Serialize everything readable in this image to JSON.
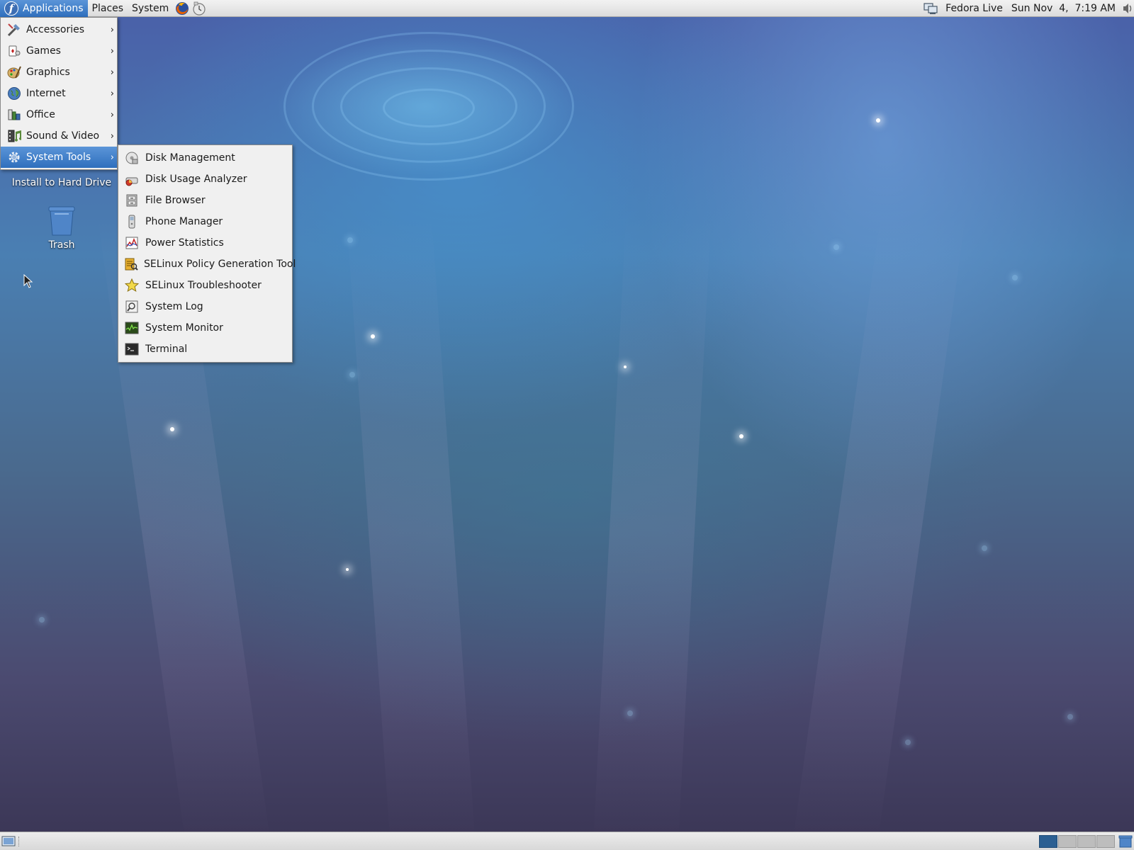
{
  "top_panel": {
    "menus": [
      {
        "label": "Applications",
        "active": true
      },
      {
        "label": "Places",
        "active": false
      },
      {
        "label": "System",
        "active": false
      }
    ],
    "launchers": [
      "firefox-icon",
      "evolution-mail-icon"
    ],
    "user_label": "Fedora Live",
    "clock": "Sun Nov  4,  7:19 AM"
  },
  "desktop": {
    "icons": [
      {
        "label": "Install to Hard Drive",
        "icon": "fedora-install-icon"
      },
      {
        "label": "Trash",
        "icon": "trash-icon"
      }
    ]
  },
  "applications_menu": {
    "items": [
      {
        "label": "Accessories",
        "icon": "accessories-icon"
      },
      {
        "label": "Games",
        "icon": "games-icon"
      },
      {
        "label": "Graphics",
        "icon": "graphics-icon"
      },
      {
        "label": "Internet",
        "icon": "internet-icon"
      },
      {
        "label": "Office",
        "icon": "office-icon"
      },
      {
        "label": "Sound & Video",
        "icon": "sound-video-icon"
      },
      {
        "label": "System Tools",
        "icon": "system-tools-icon",
        "selected": true
      }
    ],
    "arrow": "›"
  },
  "system_tools_submenu": {
    "items": [
      {
        "label": "Disk Management",
        "icon": "disk-management-icon"
      },
      {
        "label": "Disk Usage Analyzer",
        "icon": "disk-usage-icon"
      },
      {
        "label": "File Browser",
        "icon": "file-browser-icon"
      },
      {
        "label": "Phone Manager",
        "icon": "phone-icon"
      },
      {
        "label": "Power Statistics",
        "icon": "power-statistics-icon"
      },
      {
        "label": "SELinux Policy Generation Tool",
        "icon": "selinux-policy-icon"
      },
      {
        "label": "SELinux Troubleshooter",
        "icon": "star-icon"
      },
      {
        "label": "System Log",
        "icon": "system-log-icon"
      },
      {
        "label": "System Monitor",
        "icon": "system-monitor-icon"
      },
      {
        "label": "Terminal",
        "icon": "terminal-icon"
      }
    ]
  },
  "bottom_panel": {
    "workspaces": 4,
    "active_workspace": 1
  },
  "colors": {
    "menu_highlight": "#2f6fbd",
    "panel_bg": "#dcdcdc",
    "fedora_blue": "#3c6eb4"
  }
}
